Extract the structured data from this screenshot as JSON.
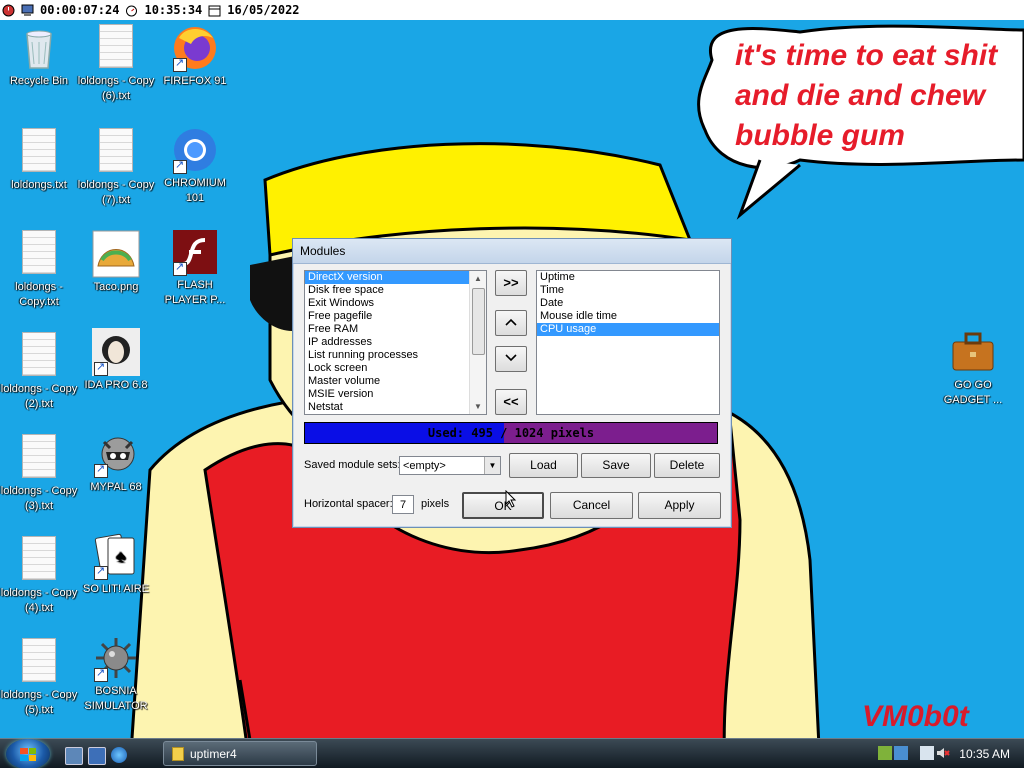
{
  "topbar": {
    "uptime": "00:00:07:24",
    "time": "10:35:34",
    "date": "16/05/2022"
  },
  "desktop_icons": {
    "col1": [
      {
        "label": "Recycle Bin"
      },
      {
        "label": "loldongs.txt"
      },
      {
        "label": "loldongs - Copy.txt"
      },
      {
        "label": "loldongs - Copy (2).txt"
      },
      {
        "label": "loldongs - Copy (3).txt"
      },
      {
        "label": "loldongs - Copy (4).txt"
      },
      {
        "label": "loldongs - Copy (5).txt"
      }
    ],
    "col2": [
      {
        "label": "loldongs - Copy (6).txt"
      },
      {
        "label": "loldongs - Copy (7).txt"
      },
      {
        "label": "Taco.png"
      },
      {
        "label": "IDA PRO 6.8"
      },
      {
        "label": "MYPAL 68"
      },
      {
        "label": "SO LIT! AIRE"
      },
      {
        "label": "BOSNIA SIMULATOR"
      }
    ],
    "col3": [
      {
        "label": "FIREFOX 91"
      },
      {
        "label": "CHROMIUM 101"
      },
      {
        "label": "FLASH PLAYER P..."
      }
    ],
    "right": {
      "label": "GO GO GADGET ..."
    }
  },
  "wallpaper": {
    "bubble_lines": [
      "it's time to eat shit",
      "and die and chew",
      "bubble gum"
    ],
    "signature": "VM0b0t"
  },
  "dialog": {
    "title": "Modules",
    "available": [
      "DirectX version",
      "Disk free space",
      "Exit Windows",
      "Free pagefile",
      "Free RAM",
      "IP addresses",
      "List running processes",
      "Lock screen",
      "Master volume",
      "MSIE version",
      "Netstat"
    ],
    "available_selected": 0,
    "active": [
      "Uptime",
      "Time",
      "Date",
      "Mouse idle time",
      "CPU usage"
    ],
    "active_selected": 4,
    "buttons": {
      "add": ">>",
      "up": "^",
      "down": "v",
      "remove": "<<"
    },
    "usage": {
      "text": "Used: 495 / 1024 pixels",
      "fraction": 0.483
    },
    "saved_sets_label": "Saved module sets:",
    "saved_sets_value": "<empty>",
    "load": "Load",
    "save": "Save",
    "delete": "Delete",
    "spacer_label": "Horizontal spacer:",
    "spacer_value": "7",
    "spacer_unit": "pixels",
    "ok": "OK",
    "cancel": "Cancel",
    "apply": "Apply"
  },
  "taskbar": {
    "task": "uptimer4",
    "clock": "10:35 AM"
  }
}
